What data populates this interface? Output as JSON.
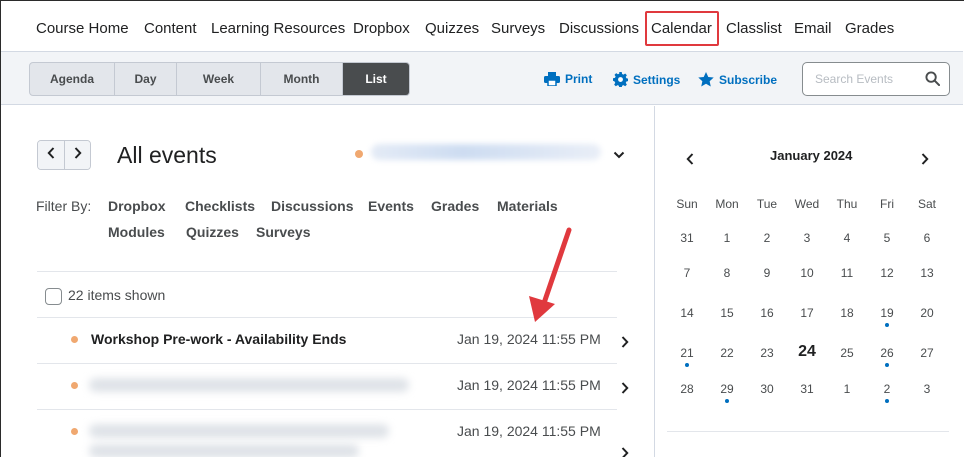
{
  "topnav": {
    "items": [
      "Course Home",
      "Content",
      "Learning Resources",
      "Dropbox",
      "Quizzes",
      "Surveys",
      "Discussions",
      "Calendar",
      "Classlist",
      "Email",
      "Grades"
    ],
    "highlighted": "Calendar",
    "highlight_color": "#e0393e"
  },
  "toolbar": {
    "views": [
      "Agenda",
      "Day",
      "Week",
      "Month",
      "List"
    ],
    "active_view": "List",
    "print_label": "Print",
    "settings_label": "Settings",
    "subscribe_label": "Subscribe",
    "search_placeholder": "Search Events",
    "link_color": "#006fbf"
  },
  "main": {
    "heading": "All events",
    "filter_label": "Filter By:",
    "filters": [
      "Dropbox",
      "Checklists",
      "Discussions",
      "Events",
      "Grades",
      "Materials",
      "Modules",
      "Quizzes",
      "Surveys"
    ],
    "items_shown": "22 items shown",
    "events": [
      {
        "title": "Workshop Pre-work - Availability Ends",
        "date": "Jan 19, 2024 11:55 PM"
      },
      {
        "title": "",
        "date": "Jan 19, 2024 11:55 PM"
      },
      {
        "title": "",
        "date": "Jan 19, 2024 11:55 PM"
      }
    ]
  },
  "calendar": {
    "month": "January 2024",
    "weekdays": [
      "Sun",
      "Mon",
      "Tue",
      "Wed",
      "Thu",
      "Fri",
      "Sat"
    ],
    "weeks": [
      [
        "31",
        "1",
        "2",
        "3",
        "4",
        "5",
        "6"
      ],
      [
        "7",
        "8",
        "9",
        "10",
        "11",
        "12",
        "13"
      ],
      [
        "14",
        "15",
        "16",
        "17",
        "18",
        "19",
        "20"
      ],
      [
        "21",
        "22",
        "23",
        "24",
        "25",
        "26",
        "27"
      ],
      [
        "28",
        "29",
        "30",
        "31",
        "1",
        "2",
        "3"
      ]
    ],
    "today": "24",
    "event_days": [
      "19",
      "21",
      "26",
      "29",
      "2"
    ],
    "event_color": "#006fbf"
  }
}
